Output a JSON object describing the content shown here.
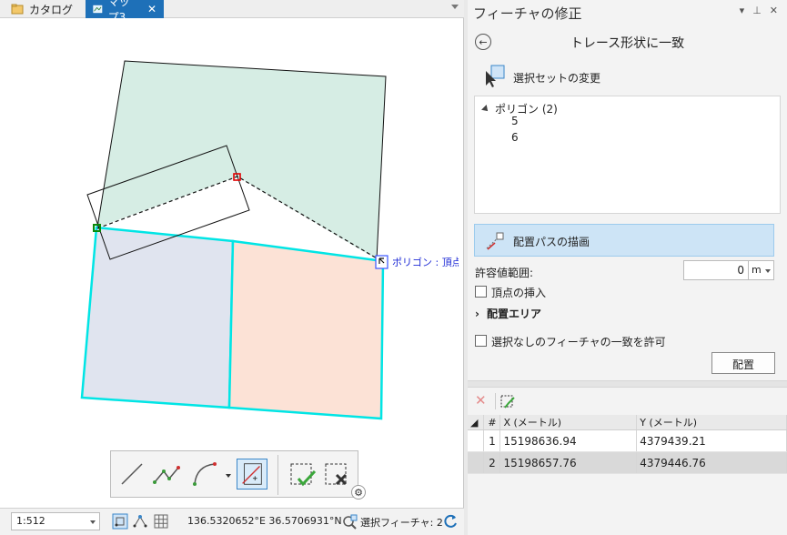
{
  "tabs": [
    {
      "label": "カタログ",
      "icon": "catalog-icon",
      "active": false
    },
    {
      "label": "マップ3",
      "icon": "map-icon",
      "active": true
    }
  ],
  "map": {
    "snap_tip": "ポリゴン : 頂点",
    "colors": {
      "green_fill": "#d6ede4",
      "blue_fill": "#e0e4ef",
      "orange_fill": "#fce2d6",
      "selection": "#00e5e5"
    }
  },
  "edit_toolbar": {
    "tools": [
      "line-icon",
      "polyline-icon",
      "arc-icon",
      "trace-icon",
      "finish-icon",
      "discard-icon"
    ]
  },
  "status": {
    "scale": "1:512",
    "coords": "136.5320652°E 36.5706931°N",
    "selected": "選択フィーチャ: 2"
  },
  "pane": {
    "title": "フィーチャの修正",
    "tool_title": "トレース形状に一致",
    "change_selection": "選択セットの変更",
    "tree": {
      "root": "ポリゴン (2)",
      "children": [
        "5",
        "6"
      ]
    },
    "draw_path": "配置パスの描画",
    "tolerance_label": "許容値範囲:",
    "tolerance_value": "0",
    "tolerance_unit": "m",
    "insert_vertices": "頂点の挿入",
    "area_section": "配置エリア",
    "allow_unselected": "選択なしのフィーチャの一致を許可",
    "apply": "配置"
  },
  "grid": {
    "headers": [
      "#",
      "X (メートル)",
      "Y (メートル)"
    ],
    "rows": [
      {
        "n": "1",
        "x": "15198636.94",
        "y": "4379439.21"
      },
      {
        "n": "2",
        "x": "15198657.76",
        "y": "4379446.76"
      }
    ]
  }
}
